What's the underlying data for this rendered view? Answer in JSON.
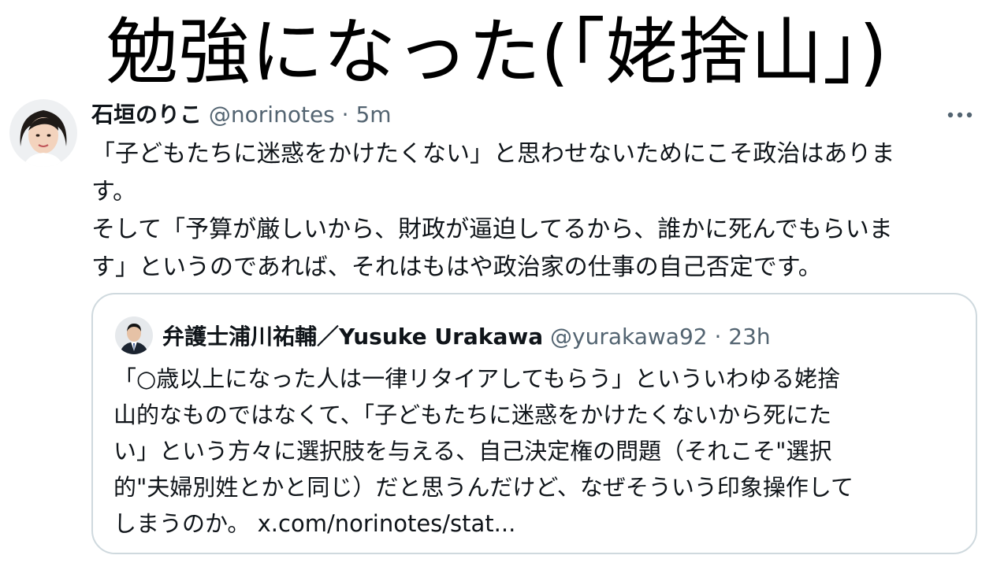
{
  "headline": "勉強になった(「姥捨山」)",
  "tweet": {
    "display_name": "石垣のりこ",
    "handle": "@norinotes",
    "separator": "·",
    "time": "5m",
    "more_icon": "more-horizontal-icon",
    "lines": [
      "「子どもたちに迷惑をかけたくない」と思わせないためにこそ政治はありま",
      "す。",
      "そして「予算が厳しいから、財政が逼迫してるから、誰かに死んでもらいま",
      "す」というのであれば、それはもはや政治家の仕事の自己否定です。"
    ]
  },
  "quote": {
    "display_name": "弁護士浦川祐輔／Yusuke Urakawa",
    "handle": "@yurakawa92",
    "separator": "·",
    "time": "23h",
    "lines": [
      "「○歳以上になった人は一律リタイアしてもらう」といういわゆる姥捨",
      "山的なものではなくて、「子どもたちに迷惑をかけたくないから死にた",
      "い」という方々に選択肢を与える、自己決定権の問題（それこそ\"選択",
      "的\"夫婦別姓とかと同じ）だと思うんだけど、なぜそういう印象操作して",
      "しまうのか。 x.com/norinotes/stat..."
    ]
  }
}
